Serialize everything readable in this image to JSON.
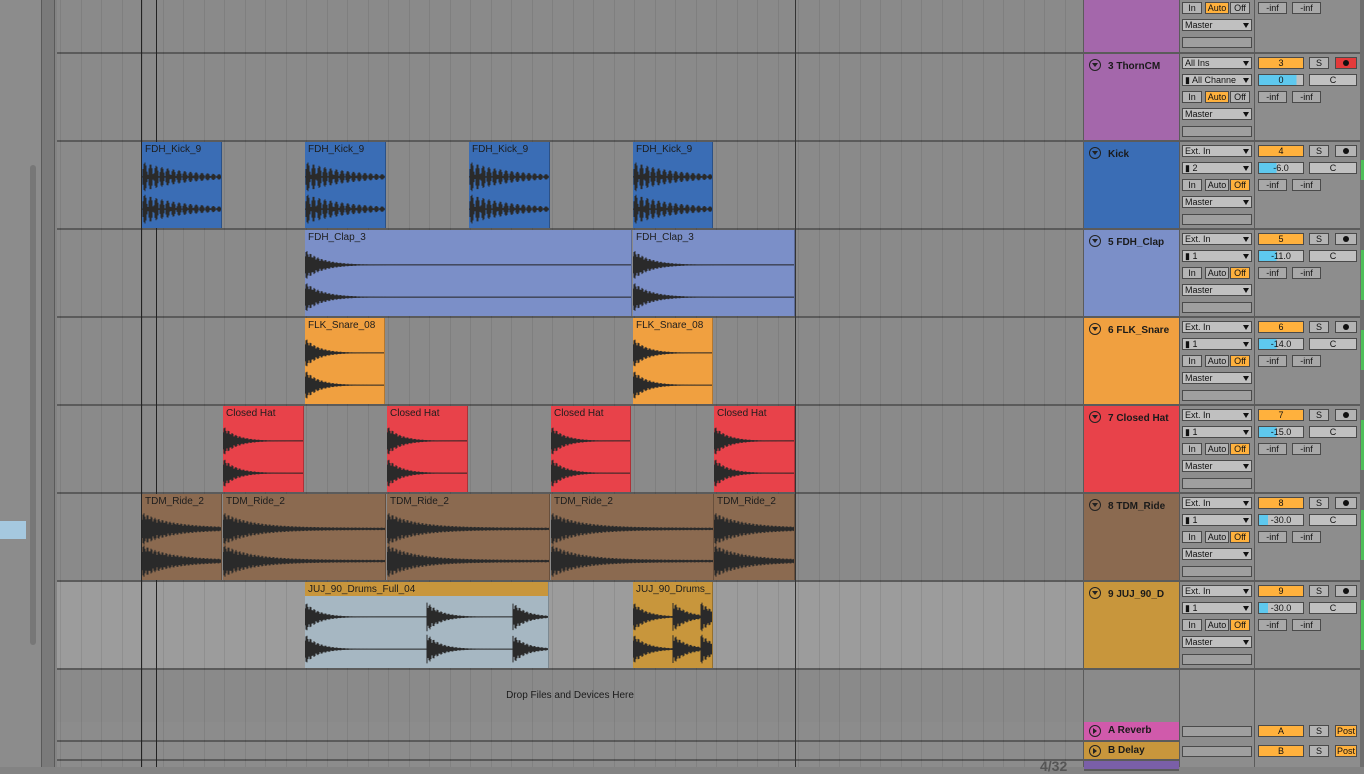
{
  "colors": {
    "kick": "#3a6db5",
    "clap": "#7b8fc8",
    "snare": "#f0a040",
    "hat": "#e8424a",
    "ride": "#8b6a50",
    "drums_header": "#c8963c",
    "drums_clip": "#a6b7c2",
    "thorn": "#a467ab",
    "reverb": "#d05aab",
    "delay": "#c8963c"
  },
  "arrangement": {
    "drop_text": "Drop Files and Devices Here",
    "clips": [
      {
        "track": "kick",
        "name": "FDH_Kick_9"
      },
      {
        "track": "kick",
        "name": "FDH_Kick_9"
      },
      {
        "track": "kick",
        "name": "FDH_Kick_9"
      },
      {
        "track": "kick",
        "name": "FDH_Kick_9"
      },
      {
        "track": "clap",
        "name": "FDH_Clap_3"
      },
      {
        "track": "clap",
        "name": "FDH_Clap_3"
      },
      {
        "track": "snare",
        "name": "FLK_Snare_08"
      },
      {
        "track": "snare",
        "name": "FLK_Snare_08"
      },
      {
        "track": "hat",
        "name": "Closed Hat"
      },
      {
        "track": "hat",
        "name": "Closed Hat"
      },
      {
        "track": "hat",
        "name": "Closed Hat"
      },
      {
        "track": "hat",
        "name": "Closed Hat"
      },
      {
        "track": "ride",
        "name": "TDM_Ride_2"
      },
      {
        "track": "ride",
        "name": "TDM_Ride_2"
      },
      {
        "track": "ride",
        "name": "TDM_Ride_2"
      },
      {
        "track": "ride",
        "name": "TDM_Ride_2"
      },
      {
        "track": "ride",
        "name": "TDM_Ride_2"
      },
      {
        "track": "drums",
        "name": "JUJ_90_Drums_Full_04"
      },
      {
        "track": "drums",
        "name": "JUJ_90_Drums_"
      }
    ]
  },
  "tracks": [
    {
      "id": "t2",
      "name": "",
      "color": "#a467ab",
      "input": "",
      "channel": "",
      "monitor_active": "Auto",
      "output": "Master",
      "number": "",
      "volume": "",
      "pan": "",
      "peak_l": "-inf",
      "peak_r": "-inf"
    },
    {
      "id": "t3",
      "name": "3 ThornCM",
      "color": "#a467ab",
      "input": "All Ins",
      "channel": "All Channe",
      "monitor_active": "Auto",
      "output": "Master",
      "number": "3",
      "volume": "0",
      "pan": "C",
      "peak_l": "-inf",
      "peak_r": "-inf",
      "arm": "on"
    },
    {
      "id": "t4",
      "name": "Kick",
      "color": "#3a6db5",
      "input": "Ext. In",
      "channel": "2",
      "monitor_active": "Off",
      "output": "Master",
      "number": "4",
      "volume": "-6.0",
      "pan": "C",
      "peak_l": "-inf",
      "peak_r": "-inf"
    },
    {
      "id": "t5",
      "name": "5 FDH_Clap",
      "color": "#7b8fc8",
      "input": "Ext. In",
      "channel": "1",
      "monitor_active": "Off",
      "output": "Master",
      "number": "5",
      "volume": "-11.0",
      "pan": "C",
      "peak_l": "-inf",
      "peak_r": "-inf"
    },
    {
      "id": "t6",
      "name": "6 FLK_Snare",
      "color": "#f0a040",
      "input": "Ext. In",
      "channel": "1",
      "monitor_active": "Off",
      "output": "Master",
      "number": "6",
      "volume": "-14.0",
      "pan": "C",
      "peak_l": "-inf",
      "peak_r": "-inf"
    },
    {
      "id": "t7",
      "name": "7 Closed Hat",
      "color": "#e8424a",
      "input": "Ext. In",
      "channel": "1",
      "monitor_active": "Off",
      "output": "Master",
      "number": "7",
      "volume": "-15.0",
      "pan": "C",
      "peak_l": "-inf",
      "peak_r": "-inf"
    },
    {
      "id": "t8",
      "name": "8 TDM_Ride",
      "color": "#8b6a50",
      "input": "Ext. In",
      "channel": "1",
      "monitor_active": "Off",
      "output": "Master",
      "number": "8",
      "volume": "-30.0",
      "pan": "C",
      "peak_l": "-inf",
      "peak_r": "-inf"
    },
    {
      "id": "t9",
      "name": "9 JUJ_90_D",
      "color": "#c8963c",
      "input": "Ext. In",
      "channel": "1",
      "monitor_active": "Off",
      "output": "Master",
      "number": "9",
      "volume": "-30.0",
      "pan": "C",
      "peak_l": "-inf",
      "peak_r": "-inf"
    }
  ],
  "returns": [
    {
      "name": "A Reverb",
      "letter": "A",
      "solo": "S",
      "post": "Post",
      "color": "#d05aab"
    },
    {
      "name": "B Delay",
      "letter": "B",
      "solo": "S",
      "post": "Post",
      "color": "#c8963c"
    }
  ],
  "labels": {
    "in": "In",
    "auto": "Auto",
    "off": "Off",
    "solo": "S"
  },
  "bottom_number": "4/32"
}
